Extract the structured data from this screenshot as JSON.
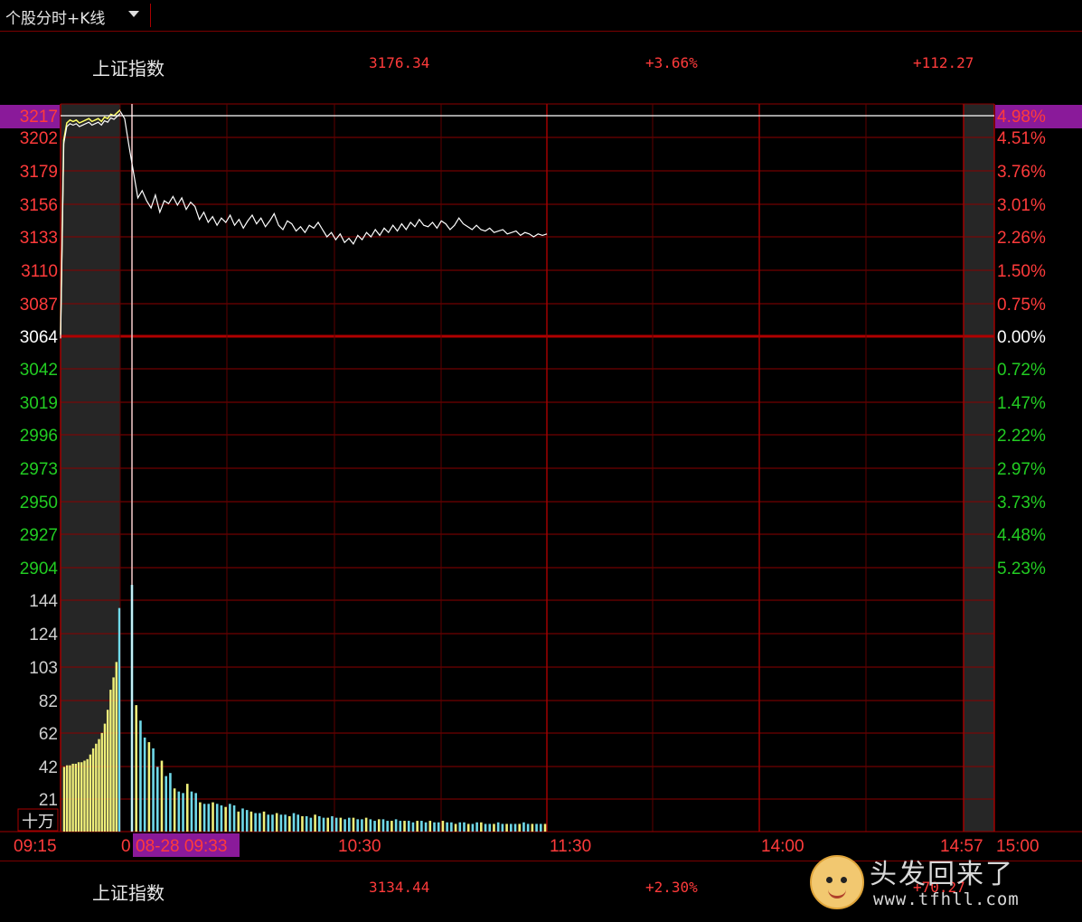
{
  "header": {
    "title": "个股分时+K线"
  },
  "quote_top": {
    "name": "上证指数",
    "price": "3176.34",
    "pct": "+3.66%",
    "change": "+112.27"
  },
  "quote_bottom": {
    "name": "上证指数",
    "price": "3134.44",
    "pct": "+2.30%",
    "change": "+70.27"
  },
  "watermark": {
    "text": "头发回来了",
    "url": "www.tfhll.com"
  },
  "colors": {
    "up": "#ff3b3b",
    "down": "#22cc22",
    "grid": "#8b0000",
    "price_line": "#ffffff",
    "avg_line": "#ffff66",
    "vol_yellow": "#f0f07a",
    "vol_cyan": "#6fd8e8",
    "highlight": "#8a1a9a"
  },
  "chart_data": {
    "type": "line",
    "price_axis": {
      "base": "3064",
      "labels_up": [
        "3217",
        "3202",
        "3179",
        "3156",
        "3133",
        "3110",
        "3087"
      ],
      "labels_down": [
        "3042",
        "3019",
        "2996",
        "2973",
        "2950",
        "2927",
        "2904"
      ],
      "pct_up": [
        "4.98%",
        "4.51%",
        "3.76%",
        "3.01%",
        "2.26%",
        "1.50%",
        "0.75%"
      ],
      "pct_base": "0.00%",
      "pct_down": [
        "0.72%",
        "1.47%",
        "2.22%",
        "2.97%",
        "3.73%",
        "4.48%",
        "5.23%"
      ],
      "ylim": [
        2904,
        3225
      ]
    },
    "volume_axis": {
      "labels": [
        "144",
        "124",
        "103",
        "82",
        "62",
        "42",
        "21"
      ],
      "unit": "十万",
      "ylim": [
        0,
        170
      ]
    },
    "time_axis": {
      "labels": [
        "09:15",
        "0",
        "10:30",
        "11:30",
        "14:00",
        "14:57",
        "15:00"
      ]
    },
    "cursor": {
      "label": "08-28 09:33",
      "price_label": "3217",
      "pct_label": "4.98%",
      "price": 3217
    },
    "auction_series": {
      "name": "",
      "x": [
        0,
        1,
        2,
        3,
        4,
        5,
        6,
        7,
        8,
        9,
        10,
        11,
        12,
        13,
        14,
        15,
        16,
        17,
        18,
        19
      ],
      "values": [
        3065,
        3200,
        3212,
        3214,
        3213,
        3214,
        3212,
        3213,
        3214,
        3215,
        3213,
        3214,
        3215,
        3213,
        3216,
        3215,
        3218,
        3217,
        3219,
        3221
      ]
    },
    "price_series": {
      "name": "",
      "values": [
        3220,
        3215,
        3196,
        3178,
        3160,
        3165,
        3158,
        3153,
        3162,
        3150,
        3158,
        3156,
        3161,
        3155,
        3160,
        3152,
        3157,
        3154,
        3145,
        3150,
        3143,
        3147,
        3141,
        3146,
        3143,
        3148,
        3141,
        3145,
        3139,
        3144,
        3148,
        3142,
        3146,
        3140,
        3144,
        3149,
        3141,
        3138,
        3144,
        3142,
        3137,
        3140,
        3136,
        3141,
        3139,
        3143,
        3138,
        3133,
        3136,
        3131,
        3135,
        3129,
        3132,
        3128,
        3134,
        3131,
        3136,
        3133,
        3138,
        3134,
        3139,
        3136,
        3141,
        3137,
        3142,
        3138,
        3143,
        3140,
        3145,
        3141,
        3140,
        3143,
        3139,
        3144,
        3142,
        3138,
        3141,
        3146,
        3142,
        3140,
        3138,
        3141,
        3138,
        3137,
        3139,
        3136,
        3137,
        3138,
        3135,
        3136,
        3137,
        3134,
        3136,
        3135,
        3133,
        3135,
        3134,
        3135
      ]
    },
    "volume_series": {
      "name": "",
      "auction": [
        42,
        43,
        43,
        44,
        44,
        45,
        45,
        46,
        47,
        50,
        54,
        57,
        60,
        64,
        70,
        79,
        92,
        100,
        110,
        145
      ],
      "trading": [
        160,
        82,
        72,
        61,
        58,
        54,
        42,
        46,
        36,
        38,
        28,
        26,
        25,
        31,
        26,
        25,
        19,
        18,
        18,
        19,
        18,
        17,
        16,
        18,
        17,
        13,
        15,
        14,
        13,
        12,
        12,
        13,
        11,
        11,
        12,
        11,
        11,
        10,
        12,
        11,
        10,
        10,
        9,
        11,
        10,
        9,
        9,
        10,
        9,
        9,
        8,
        9,
        9,
        8,
        8,
        9,
        8,
        7,
        8,
        8,
        7,
        7,
        8,
        7,
        7,
        7,
        6,
        7,
        7,
        6,
        7,
        6,
        6,
        7,
        6,
        6,
        5,
        6,
        6,
        5,
        5,
        6,
        6,
        5,
        5,
        5,
        6,
        5,
        5,
        5,
        5,
        5,
        6,
        5,
        5,
        5,
        5,
        5
      ]
    }
  }
}
